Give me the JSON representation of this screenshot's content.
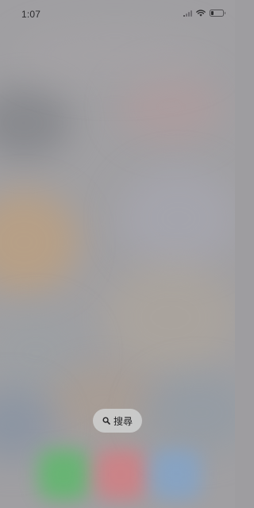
{
  "status_bar": {
    "time": "1:07",
    "signal_icon": "cellular-signal-icon",
    "wifi_icon": "wifi-icon",
    "battery_icon": "battery-icon",
    "battery_level": 0.2
  },
  "search": {
    "icon": "search-icon",
    "label": "搜尋"
  },
  "dock": {
    "apps": [
      {
        "icon": "phone-app-icon",
        "color": "#5fb86c"
      },
      {
        "icon": "red-app-icon",
        "color": "#d97a7f"
      },
      {
        "icon": "blue-app-icon",
        "color": "#7ea5cf"
      }
    ]
  }
}
